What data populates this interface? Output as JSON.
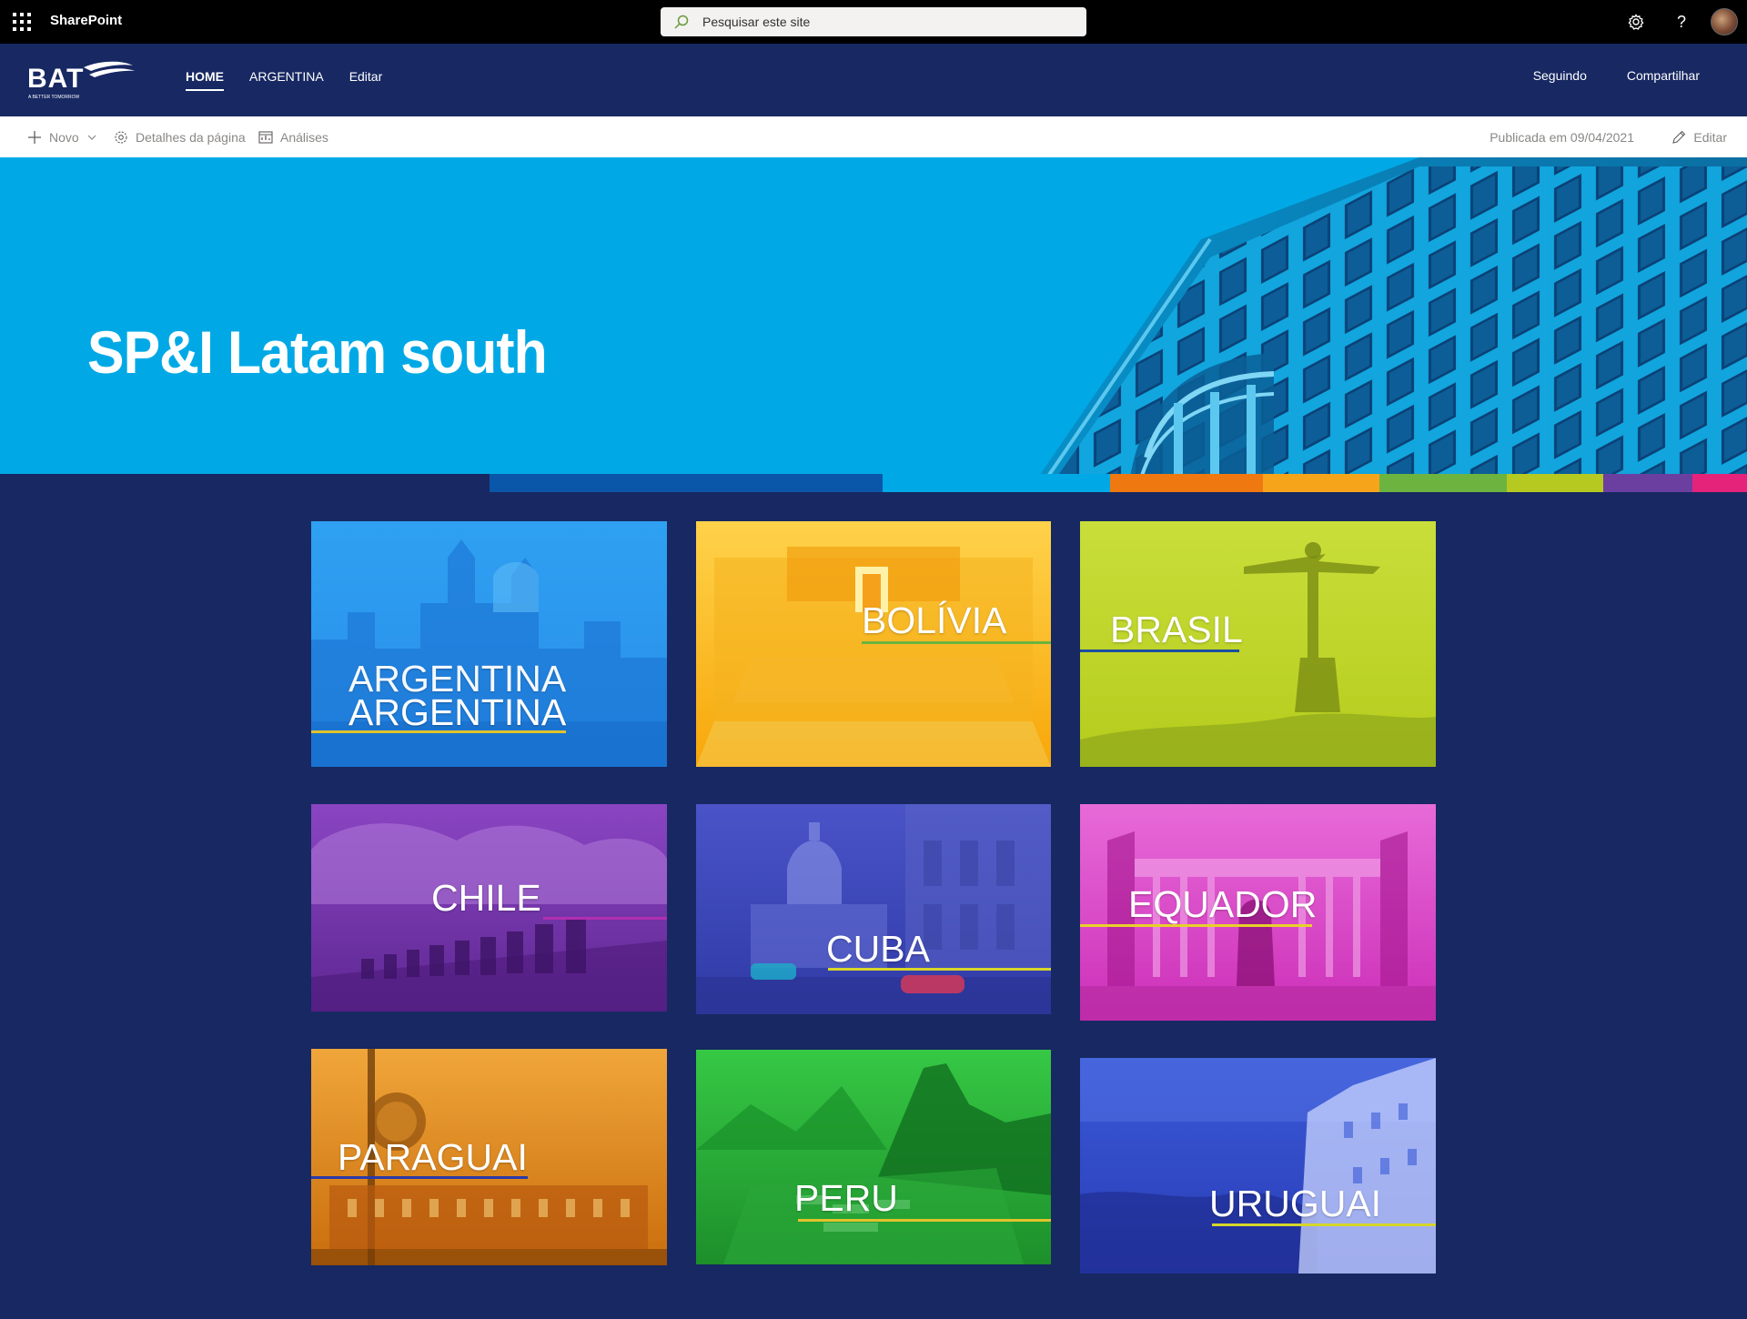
{
  "suite_bar": {
    "app_name": "SharePoint",
    "search_placeholder": "Pesquisar este site",
    "icons": [
      "app-launcher-icon",
      "search-icon",
      "settings-gear-icon",
      "help-icon",
      "user-avatar"
    ]
  },
  "site_header": {
    "logo_text": "BAT",
    "logo_tagline": "A BETTER TOMORROW",
    "nav": [
      {
        "label": "HOME",
        "active": true
      },
      {
        "label": "ARGENTINA",
        "active": false
      },
      {
        "label": "Editar",
        "active": false
      }
    ],
    "actions": {
      "follow": "Seguindo",
      "share": "Compartilhar"
    }
  },
  "command_bar": {
    "new_label": "Novo",
    "page_details_label": "Detalhes da página",
    "analytics_label": "Análises",
    "published_label": "Publicada em 09/04/2021",
    "edit_label": "Editar"
  },
  "hero": {
    "title": "SP&I Latam south",
    "colors": {
      "background": "#00a9e6",
      "dark_navy": "#172862",
      "blue": "#0a56a8",
      "orange": "#f07810",
      "amber": "#f6a51a",
      "green": "#6db33f",
      "lime": "#b5c920",
      "purple": "#6b3fa0",
      "pink": "#e5237a"
    }
  },
  "tiles": [
    {
      "label": "ARGENTINA",
      "label_repeat": "ARGENTINA",
      "color": "#1f8fe8"
    },
    {
      "label": "BOLÍVIA",
      "color": "#f7a70a"
    },
    {
      "label": "BRASIL",
      "color": "#b8d02a"
    },
    {
      "label": "CHILE",
      "color": "#6d2ea0"
    },
    {
      "label": "CUBA",
      "color": "#3a46b5"
    },
    {
      "label": "EQUADOR",
      "color": "#d83ec6"
    },
    {
      "label": "PARAGUAI",
      "color": "#e38a1c"
    },
    {
      "label": "PERU",
      "color": "#25a63a"
    },
    {
      "label": "URUGUAI",
      "color": "#2a46c4"
    }
  ]
}
